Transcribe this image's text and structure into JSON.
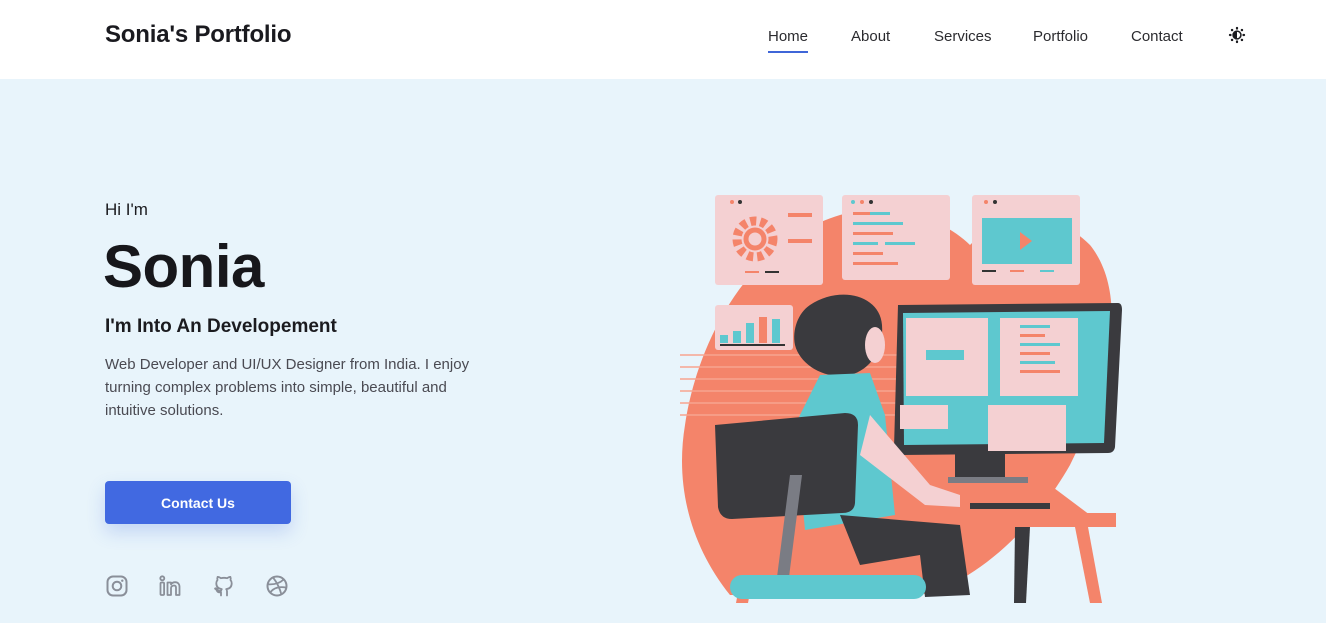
{
  "header": {
    "logo": "Sonia's Portfolio",
    "nav": [
      "Home",
      "About",
      "Services",
      "Portfolio",
      "Contact"
    ],
    "active": "Home",
    "theme_toggle_icon": "theme-toggle-icon"
  },
  "hero": {
    "greeting": "Hi I'm",
    "name": "Sonia",
    "tagline": "I'm Into An Developement",
    "description": "Web Developer and UI/UX Designer from India. I enjoy turning complex problems into simple, beautiful and intuitive solutions.",
    "cta_label": "Contact Us",
    "socials": [
      "instagram-icon",
      "linkedin-icon",
      "github-icon",
      "dribbble-icon"
    ]
  },
  "colors": {
    "accent": "#4169e1",
    "background": "#e8f4fb",
    "illustration_coral": "#f4846a",
    "illustration_teal": "#5ec8cf"
  }
}
